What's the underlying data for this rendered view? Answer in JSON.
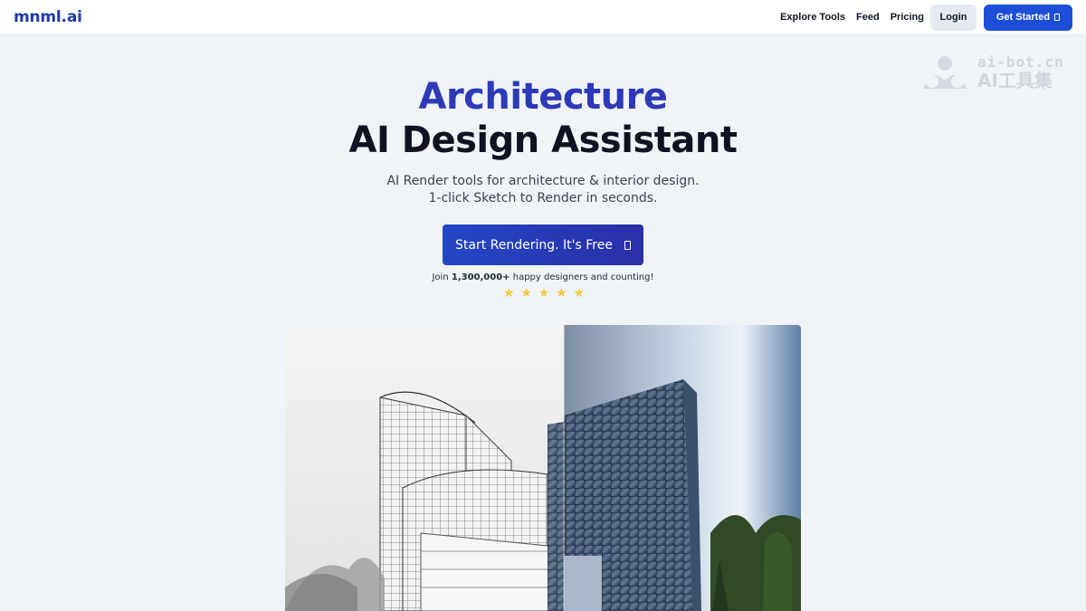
{
  "nav": {
    "logo": "mnml.ai",
    "links": [
      {
        "label": "Explore Tools"
      },
      {
        "label": "Feed"
      },
      {
        "label": "Pricing"
      }
    ],
    "login_label": "Login",
    "get_started_label": "Get Started"
  },
  "watermark": {
    "line1": "ai-bot.cn",
    "line2": "AI工具集"
  },
  "hero": {
    "title_line1": "Architecture",
    "title_line2": "AI Design Assistant",
    "subtitle_line1": "AI Render tools for architecture & interior design.",
    "subtitle_line2": "1-click Sketch to Render in seconds.",
    "cta_label": "Start Rendering. It's Free",
    "social_prefix": "Join ",
    "social_count": "1,300,000+",
    "social_suffix": " happy designers and counting!",
    "rating_stars": 5
  },
  "colors": {
    "brand": "#1e3aa8",
    "title_accent": "#2d3ab8",
    "primary_button": "#1d4ed8",
    "star": "#f6c842",
    "background": "#f0f3f8"
  },
  "icons": {
    "cta_arrow": "arrow-right-icon",
    "get_started_arrow": "arrow-right-icon",
    "star": "star-icon"
  }
}
